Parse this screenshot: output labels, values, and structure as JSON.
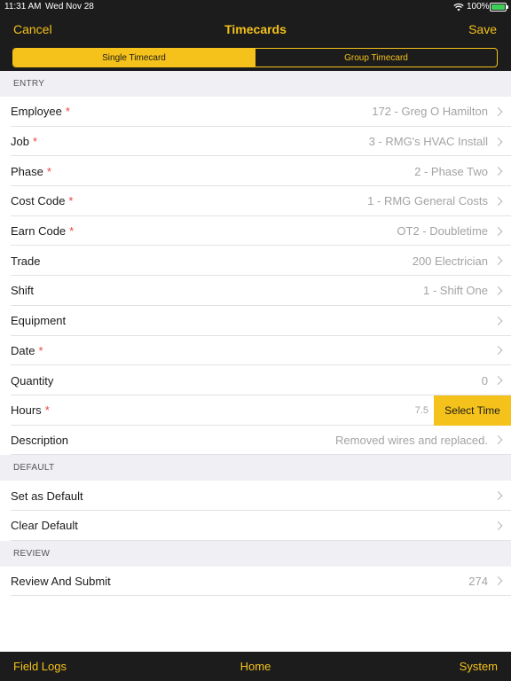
{
  "status_bar": {
    "time": "11:31 AM",
    "date": "Wed Nov 28",
    "battery": "100%"
  },
  "nav": {
    "cancel": "Cancel",
    "title": "Timecards",
    "save": "Save",
    "segments": [
      "Single Timecard",
      "Group Timecard"
    ],
    "selected_segment": "Single Timecard"
  },
  "sections": {
    "entry": "ENTRY",
    "default": "DEFAULT",
    "review": "REVIEW"
  },
  "entry_rows": {
    "employee": {
      "label": "Employee",
      "required": "*",
      "value": "172 - Greg O Hamilton"
    },
    "job": {
      "label": "Job",
      "required": "*",
      "value": "3 - RMG's HVAC Install"
    },
    "phase": {
      "label": "Phase",
      "required": "*",
      "value": "2 - Phase Two"
    },
    "cost_code": {
      "label": "Cost Code",
      "required": "*",
      "value": "1 - RMG General Costs"
    },
    "earn_code": {
      "label": "Earn Code",
      "required": "*",
      "value": "OT2 - Doubletime"
    },
    "trade": {
      "label": "Trade",
      "value": "200 Electrician"
    },
    "shift": {
      "label": "Shift",
      "value": "1 - Shift One"
    },
    "equipment": {
      "label": "Equipment",
      "value": ""
    },
    "date": {
      "label": "Date",
      "required": "*",
      "value": ""
    },
    "quantity": {
      "label": "Quantity",
      "value": "0"
    },
    "hours": {
      "label": "Hours",
      "required": "*",
      "value": "7.5",
      "button": "Select Time"
    },
    "description": {
      "label": "Description",
      "value": "Removed wires and replaced."
    }
  },
  "default_rows": {
    "set_default": {
      "label": "Set as Default"
    },
    "clear_default": {
      "label": "Clear Default"
    }
  },
  "review_rows": {
    "review_submit": {
      "label": "Review And Submit",
      "value": "274"
    }
  },
  "tab_bar": {
    "left": "Field Logs",
    "center": "Home",
    "right": "System"
  },
  "colors": {
    "accent": "#f4c21a",
    "bar_background": "#1c1c1c",
    "required": "#e8473f",
    "section_background": "#efeff4"
  },
  "icons": [
    "wifi-icon",
    "battery-icon",
    "chevron-right-icon"
  ]
}
